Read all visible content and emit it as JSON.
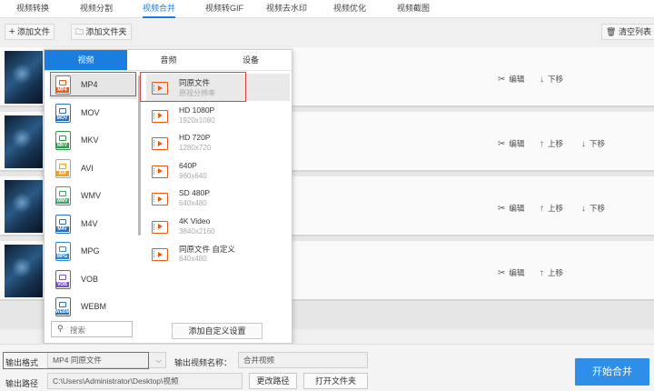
{
  "tabs": [
    "视频转换",
    "视频分割",
    "视频合并",
    "视频转GIF",
    "视频去水印",
    "视频优化",
    "视频截图"
  ],
  "active_tab_index": 2,
  "toolbar": {
    "add_file": "添加文件",
    "add_folder": "添加文件夹",
    "clear_list": "清空列表"
  },
  "rows": [
    {
      "edit": "编辑",
      "up": "",
      "down": "下移"
    },
    {
      "edit": "编辑",
      "up": "上移",
      "down": "下移"
    },
    {
      "edit": "编辑",
      "up": "上移",
      "down": "下移"
    },
    {
      "edit": "编辑",
      "up": "上移",
      "down": ""
    }
  ],
  "popup": {
    "tabs": [
      "视频",
      "音频",
      "设备"
    ],
    "active_tab_index": 0,
    "formats": [
      "MP4",
      "MOV",
      "MKV",
      "AVI",
      "WMV",
      "M4V",
      "MPG",
      "VOB",
      "WEBM"
    ],
    "format_colors": [
      "#e85a1b",
      "#2a6fc2",
      "#2e9a4a",
      "#f0a020",
      "#3aa66a",
      "#2a6fc2",
      "#2f86d0",
      "#7a52c8",
      "#2a6fc2"
    ],
    "selected_format_index": 0,
    "presets": [
      {
        "name": "同原文件",
        "res": "原视分辨率"
      },
      {
        "name": "HD 1080P",
        "res": "1920x1080"
      },
      {
        "name": "HD 720P",
        "res": "1280x720"
      },
      {
        "name": "640P",
        "res": "960x640"
      },
      {
        "name": "SD 480P",
        "res": "640x480"
      },
      {
        "name": "4K Video",
        "res": "3840x2160"
      },
      {
        "name": "同原文件 自定义",
        "res": "640x480"
      }
    ],
    "selected_preset_index": 0,
    "search_placeholder": "搜索",
    "custom_button": "添加自定义设置"
  },
  "bottom": {
    "output_format_label": "输出格式",
    "output_format_value": "MP4 同原文件",
    "output_name_label": "输出视频名称：",
    "output_name_value": "合并视频",
    "output_path_label": "输出路径",
    "output_path_value": "C:\\Users\\Administrator\\Desktop\\视频",
    "change_path": "更改路径",
    "open_folder": "打开文件夹",
    "start": "开始合并"
  }
}
